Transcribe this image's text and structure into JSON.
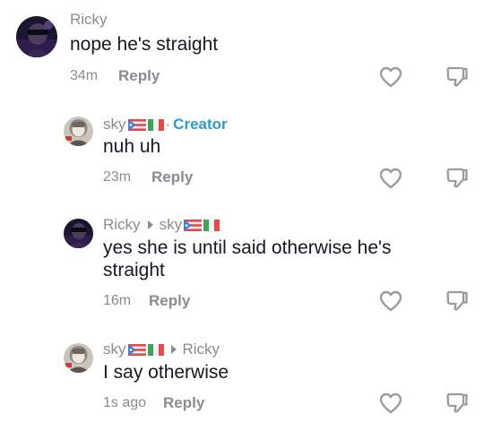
{
  "comments": [
    {
      "author": "Ricky",
      "text": "nope he's straight",
      "time": "34m",
      "reply_label": "Reply"
    },
    {
      "author": "sky",
      "author_flags": [
        "puerto-rico-flag",
        "italy-flag"
      ],
      "creator_label": "Creator",
      "text": "nuh uh",
      "time": "23m",
      "reply_label": "Reply"
    },
    {
      "author": "Ricky",
      "replying_to": "sky",
      "replying_to_flags": [
        "puerto-rico-flag",
        "italy-flag"
      ],
      "text": "yes she is until said otherwise he's\nstraight",
      "time": "16m",
      "reply_label": "Reply"
    },
    {
      "author": "sky",
      "author_flags": [
        "puerto-rico-flag",
        "italy-flag"
      ],
      "replying_to": "Ricky",
      "text": "I say otherwise",
      "time": "1s ago",
      "reply_label": "Reply"
    }
  ],
  "icons": {
    "like": "heart-outline-icon",
    "dislike": "thumbs-down-outline-icon",
    "reply_arrow": "triangle-right-icon"
  },
  "colors": {
    "text": "#161823",
    "muted": "#8a8b91",
    "creator": "#2d9bc4"
  }
}
